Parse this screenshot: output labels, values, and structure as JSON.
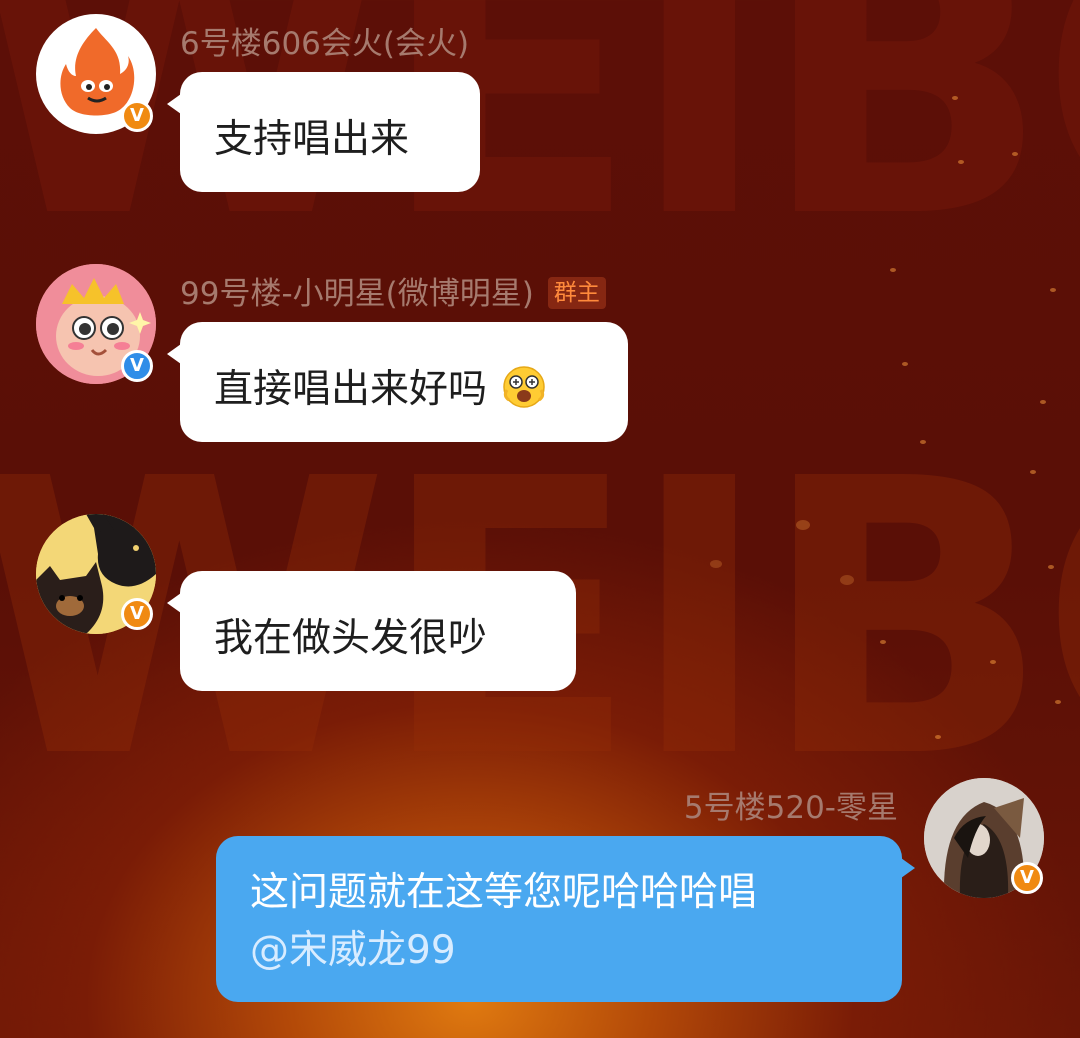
{
  "messages": [
    {
      "sender": "6号楼606会火(会火)",
      "text": "支持唱出来",
      "avatar": "flame-mascot-avatar",
      "badge": "V",
      "badge_color": "#f08a12"
    },
    {
      "sender": "99号楼-小明星(微博明星)",
      "role_tag": "群主",
      "text": "直接唱出来好吗",
      "emoji": "star-eyes-emoji",
      "avatar": "crowned-cartoon-avatar",
      "badge": "V",
      "badge_color": "#2f8de8"
    },
    {
      "sender": "",
      "text": "我在做头发很吵",
      "avatar": "cats-photo-avatar",
      "badge": "V",
      "badge_color": "#f08a12"
    },
    {
      "sender": "5号楼520-零星",
      "text": "这问题就在这等您呢哈哈哈唱",
      "mention": "@宋威龙99",
      "avatar": "hooded-person-avatar",
      "badge": "V",
      "badge_color": "#f08a12",
      "outgoing": true,
      "bubble_color": "#4aa8f0"
    }
  ],
  "background": {
    "watermark_text": "WEIBO",
    "colors": [
      "#5c0f07",
      "#e07a10"
    ]
  }
}
